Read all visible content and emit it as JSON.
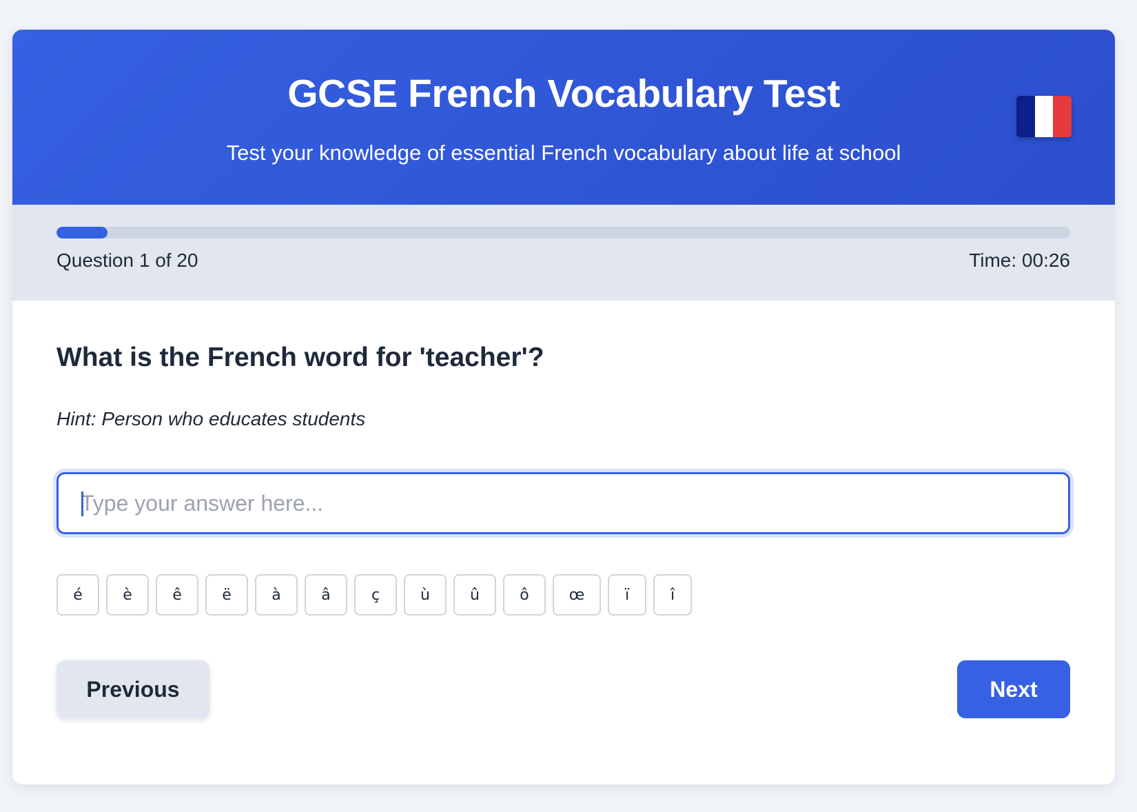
{
  "header": {
    "title": "GCSE French Vocabulary Test",
    "subtitle": "Test your knowledge of essential French vocabulary about life at school",
    "flag_colors": [
      "#0d1f8c",
      "#ffffff",
      "#e53b3f"
    ],
    "flag_icon": "france-flag-icon"
  },
  "progress": {
    "fraction": 0.05,
    "question_label": "Question 1 of 20",
    "timer_label": "Time: 00:26",
    "accent_color": "#3561e2"
  },
  "question": {
    "text": "What is the French word for 'teacher'?",
    "hint": "Hint: Person who educates students"
  },
  "answer": {
    "value": "",
    "placeholder": "Type your answer here..."
  },
  "accents": [
    "é",
    "è",
    "ê",
    "ë",
    "à",
    "â",
    "ç",
    "ù",
    "û",
    "ô",
    "œ",
    "ï",
    "î"
  ],
  "nav": {
    "previous_label": "Previous",
    "next_label": "Next"
  }
}
